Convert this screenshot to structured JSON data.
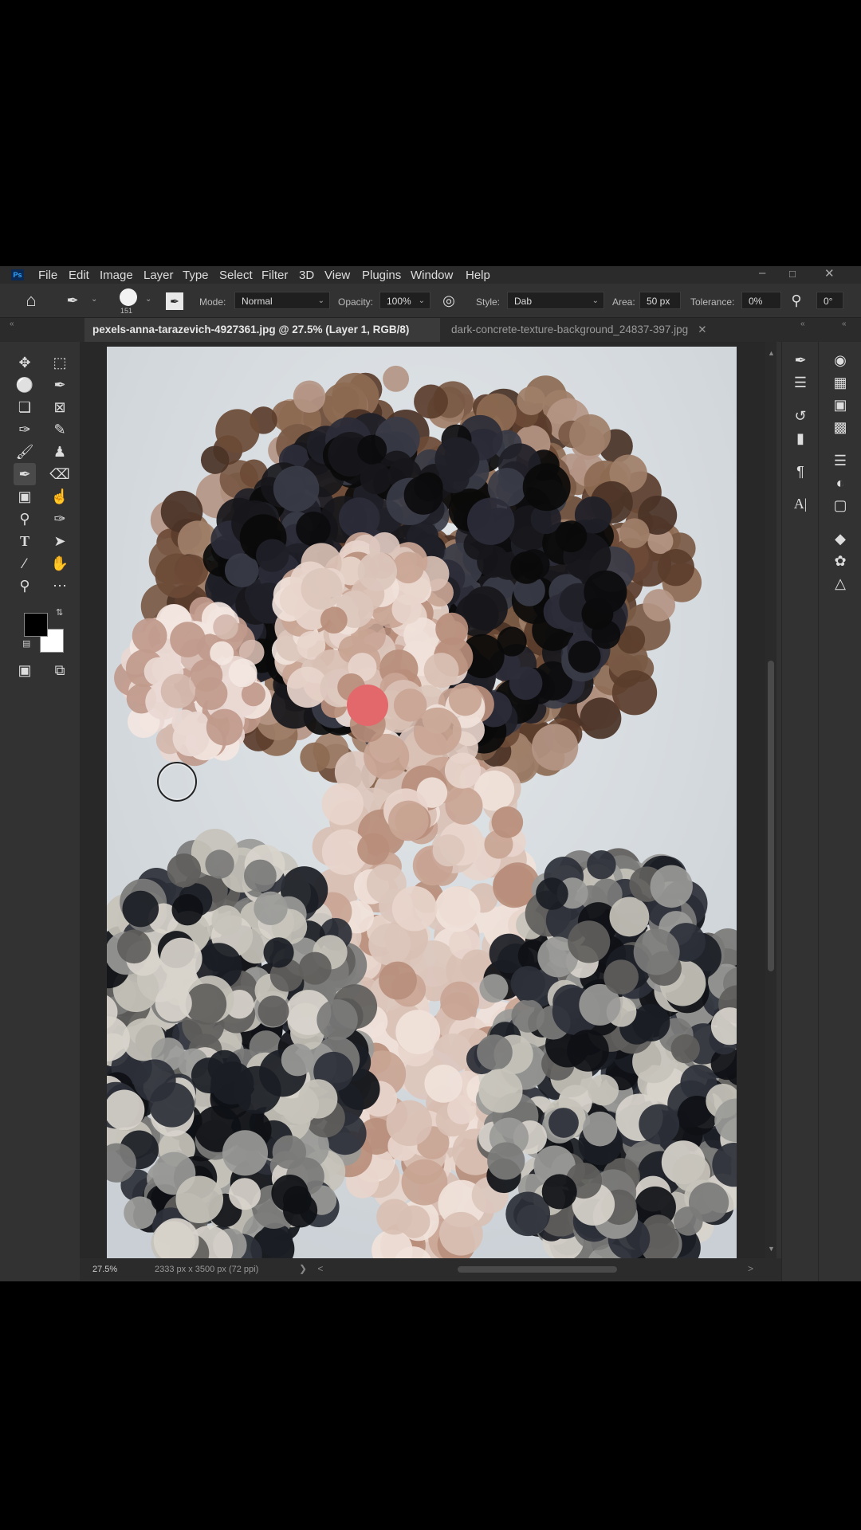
{
  "app": {
    "logo": "Ps",
    "menu": [
      "File",
      "Edit",
      "Image",
      "Layer",
      "Type",
      "Select",
      "Filter",
      "3D",
      "View",
      "Plugins",
      "Window",
      "Help"
    ],
    "window_controls": [
      "minimize-icon",
      "restore-icon",
      "close-icon"
    ]
  },
  "options": {
    "brush_size": "151",
    "mode_label": "Mode:",
    "mode_value": "Normal",
    "opacity_label": "Opacity:",
    "opacity_value": "100%",
    "style_label": "Style:",
    "style_value": "Dab",
    "area_label": "Area:",
    "area_value": "50 px",
    "tolerance_label": "Tolerance:",
    "tolerance_value": "0%",
    "angle_value": "0°"
  },
  "tabs": [
    {
      "label": "pexels-anna-tarazevich-4927361.jpg @ 27.5% (Layer 1, RGB/8) *",
      "active": true
    },
    {
      "label": "dark-concrete-texture-background_24837-397.jpg",
      "active": false
    }
  ],
  "tools": [
    "move-tool-icon",
    "marquee-tool-icon",
    "lasso-tool-icon",
    "quick-selection-icon",
    "crop-tool-icon",
    "frame-tool-icon",
    "eyedropper-icon",
    "healing-brush-icon",
    "brush-tool-icon",
    "clone-stamp-icon",
    "art-history-brush-icon",
    "eraser-icon",
    "gradient-tool-icon",
    "smudge-tool-icon",
    "dodge-tool-icon",
    "pen-tool-icon",
    "type-tool-icon",
    "path-selection-icon",
    "line-tool-icon",
    "hand-tool-icon",
    "zoom-tool-icon",
    "more-tools-icon"
  ],
  "colors": {
    "foreground": "#000000",
    "background": "#ffffff",
    "canvas_bg": "#dde2e6"
  },
  "status": {
    "zoom": "27.5%",
    "doc_info": "2333 px x 3500 px (72 ppi)"
  },
  "panels_left": [
    "brush-settings-icon",
    "brush-presets-icon",
    "history-icon",
    "comments-icon",
    "paragraph-icon",
    "character-icon"
  ],
  "panels_right": [
    "color-icon",
    "swatches-icon",
    "gradients-icon",
    "patterns-icon",
    "properties-icon",
    "adjustments-icon",
    "libraries-icon",
    "layers-icon",
    "channels-icon",
    "paths-icon"
  ]
}
